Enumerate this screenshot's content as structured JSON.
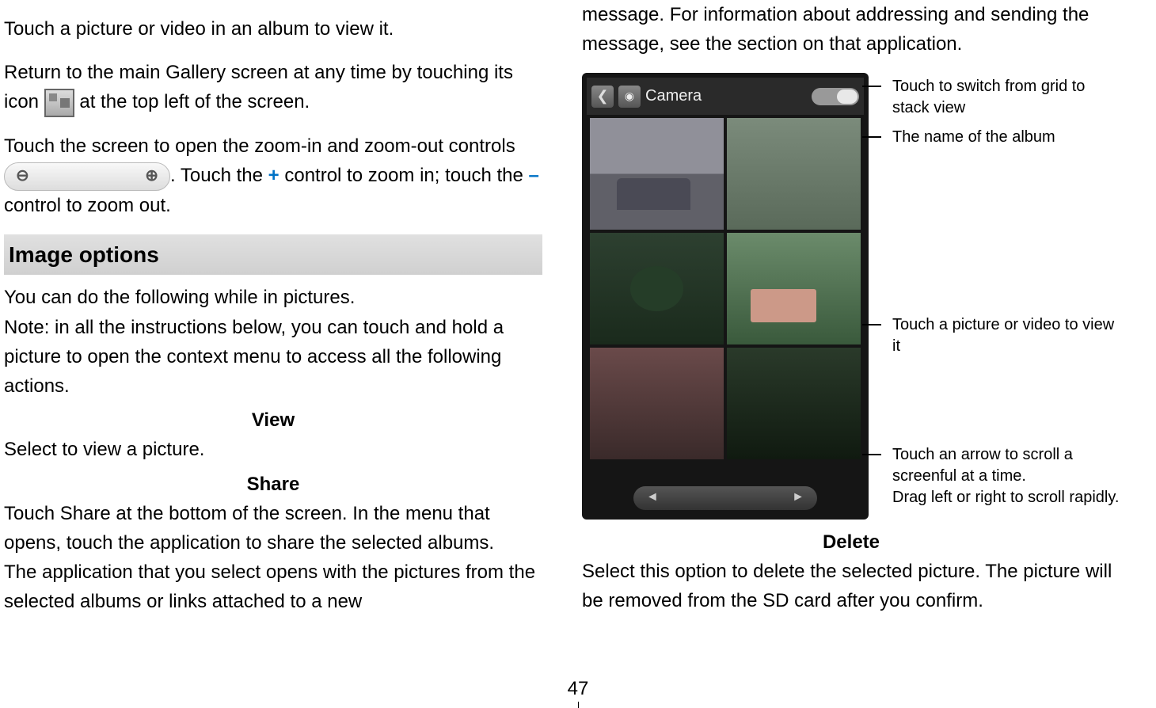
{
  "left": {
    "p1": "Touch a picture or video in an album to view it.",
    "p2a": "Return to the main Gallery screen at any time by touching its icon ",
    "p2b": " at the top left of the screen.",
    "p3a": "Touch the screen to open the zoom-in and zoom-out controls",
    "p3b": ". Touch the ",
    "plus": "+",
    "p3c": " control to zoom in; touch the ",
    "minus": "–",
    "p3d": " control to zoom out.",
    "h1": "Image options",
    "p4": "You can do the following while in pictures.",
    "p5": "Note: in all the instructions below, you can touch and hold a picture to open the context menu to access all the following actions.",
    "sh_view": "View",
    "p6": "Select to view a picture.",
    "sh_share": "Share",
    "p7": "Touch Share at the bottom of the screen. In the menu that opens, touch the application to share the selected albums.",
    "p8": "The application that you select opens with the pictures from the selected albums or links attached to a new"
  },
  "right": {
    "p1": "message. For information about addressing and sending the message, see the section on that application.",
    "album_label": "Camera",
    "ann1": "Touch to switch from grid to stack view",
    "ann2": "The name of the album",
    "ann3": "Touch a picture or video to view it",
    "ann4a": "Touch an arrow to scroll a screenful at a time.",
    "ann4b": "Drag left or right to scroll rapidly.",
    "sh_delete": "Delete",
    "p2": "Select this option to delete the selected picture. The picture will be removed from the SD card after you confirm."
  },
  "page_number": "47"
}
